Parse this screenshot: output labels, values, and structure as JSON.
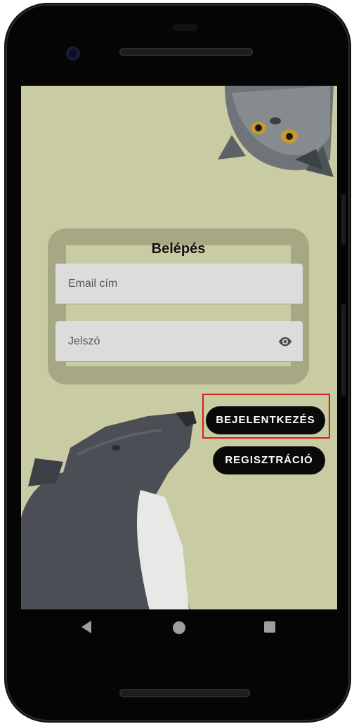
{
  "login": {
    "title": "Belépés",
    "email_placeholder": "Email cím",
    "password_placeholder": "Jelszó",
    "login_button": "BEJELENTKEZÉS",
    "register_button": "REGISZTRÁCIÓ"
  },
  "icons": {
    "password_toggle": "eye-icon",
    "nav_back": "back-icon",
    "nav_home": "home-icon",
    "nav_recent": "recent-apps-icon"
  },
  "colors": {
    "background": "#c9cca3",
    "card": "#a6a884",
    "field": "#dddcdc",
    "button": "#0a0a0a",
    "highlight": "#d81b1b"
  }
}
